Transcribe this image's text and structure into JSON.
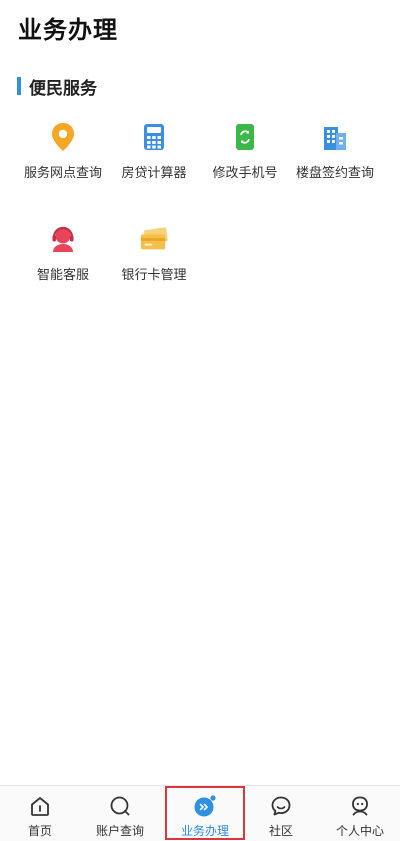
{
  "header": {
    "title": "业务办理"
  },
  "section": {
    "title": "便民服务"
  },
  "services": [
    {
      "label": "服务网点查询",
      "icon": "location-pin-icon",
      "color": "#f5a623"
    },
    {
      "label": "房贷计算器",
      "icon": "calculator-icon",
      "color": "#3a8fe0"
    },
    {
      "label": "修改手机号",
      "icon": "phone-refresh-icon",
      "color": "#3cb84a"
    },
    {
      "label": "楼盘签约查询",
      "icon": "building-icon",
      "color": "#3a8fe0"
    },
    {
      "label": "智能客服",
      "icon": "headset-agent-icon",
      "color": "#e8455a"
    },
    {
      "label": "银行卡管理",
      "icon": "bank-cards-icon",
      "color": "#f5c04a"
    }
  ],
  "tabbar": {
    "active_color": "#2f8fe0",
    "highlight_color": "#d9363e",
    "tabs": [
      {
        "label": "首页",
        "icon": "home-icon"
      },
      {
        "label": "账户查询",
        "icon": "account-search-icon"
      },
      {
        "label": "业务办理",
        "icon": "business-icon",
        "active": true
      },
      {
        "label": "社区",
        "icon": "community-chat-icon"
      },
      {
        "label": "个人中心",
        "icon": "profile-icon"
      }
    ]
  }
}
